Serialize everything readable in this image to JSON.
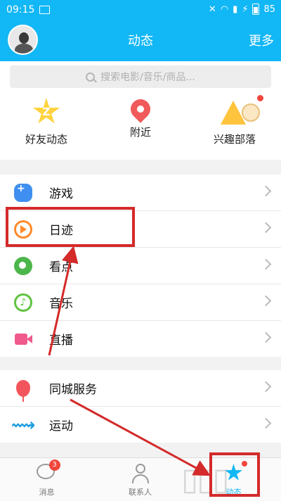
{
  "status_bar": {
    "time": "09:15",
    "battery": "85"
  },
  "header": {
    "title": "动态",
    "more_label": "更多"
  },
  "search": {
    "placeholder": "搜索电影/音乐/商品..."
  },
  "quick_entries": [
    {
      "label": "好友动态",
      "icon": "qzone-star-icon"
    },
    {
      "label": "附近",
      "icon": "location-pin-icon"
    },
    {
      "label": "兴趣部落",
      "icon": "tribe-tent-icon"
    }
  ],
  "list_section_1": [
    {
      "label": "游戏",
      "icon": "gamepad-icon"
    },
    {
      "label": "日迹",
      "icon": "diary-play-icon"
    },
    {
      "label": "看点",
      "icon": "eye-icon"
    },
    {
      "label": "音乐",
      "icon": "music-note-icon"
    },
    {
      "label": "直播",
      "icon": "video-camera-icon"
    }
  ],
  "list_section_2": [
    {
      "label": "同城服务",
      "icon": "balloon-icon"
    },
    {
      "label": "运动",
      "icon": "running-icon"
    }
  ],
  "tab_bar": [
    {
      "label": "消息",
      "icon": "message-bubble-icon",
      "badge": "3"
    },
    {
      "label": "联系人",
      "icon": "contacts-person-icon"
    },
    {
      "label": "动态",
      "icon": "star-icon"
    }
  ],
  "colors": {
    "brand": "#12b7f5",
    "annotation": "#d42a2a"
  }
}
